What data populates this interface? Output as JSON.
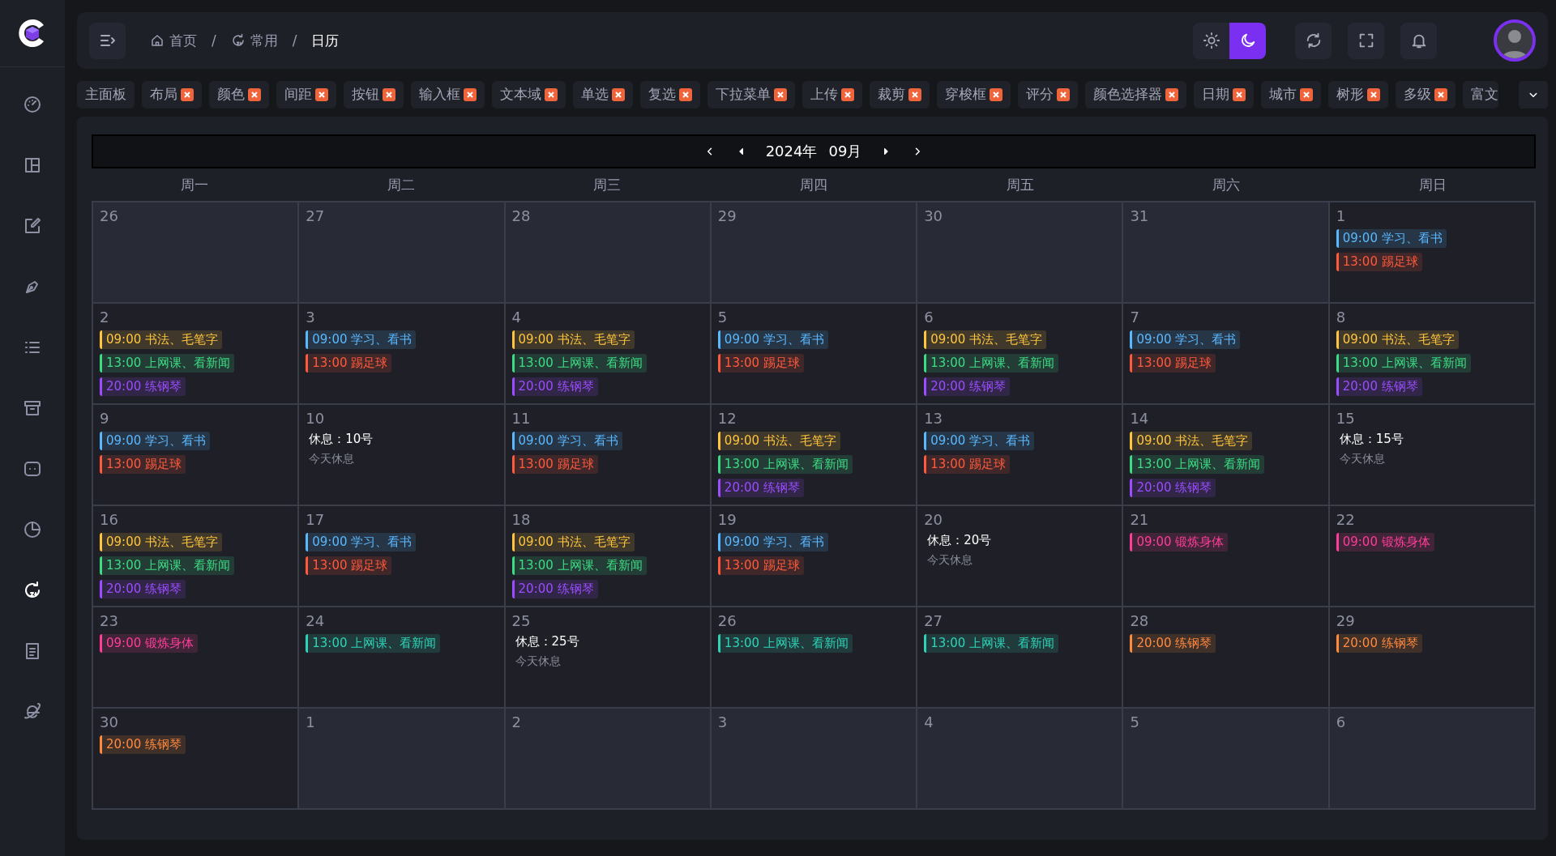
{
  "sidebar": {
    "items": [
      {
        "selected": false
      },
      {
        "selected": false
      },
      {
        "selected": false
      },
      {
        "selected": false
      },
      {
        "selected": false
      },
      {
        "selected": false
      },
      {
        "selected": false
      },
      {
        "selected": false
      },
      {
        "selected": true
      },
      {
        "selected": false
      },
      {
        "selected": false
      }
    ]
  },
  "header": {
    "breadcrumbs": [
      {
        "label": "首页",
        "current": false
      },
      {
        "label": "常用",
        "current": false
      },
      {
        "label": "日历",
        "current": true
      }
    ],
    "separators": [
      "/",
      "/"
    ],
    "theme": [
      {
        "selected": false
      },
      {
        "selected": true
      }
    ]
  },
  "tabs": [
    {
      "label": "主面板",
      "closable": false
    },
    {
      "label": "布局",
      "closable": true
    },
    {
      "label": "颜色",
      "closable": true
    },
    {
      "label": "间距",
      "closable": true
    },
    {
      "label": "按钮",
      "closable": true
    },
    {
      "label": "输入框",
      "closable": true
    },
    {
      "label": "文本域",
      "closable": true
    },
    {
      "label": "单选",
      "closable": true
    },
    {
      "label": "复选",
      "closable": true
    },
    {
      "label": "下拉菜单",
      "closable": true
    },
    {
      "label": "上传",
      "closable": true
    },
    {
      "label": "裁剪",
      "closable": true
    },
    {
      "label": "穿梭框",
      "closable": true
    },
    {
      "label": "评分",
      "closable": true
    },
    {
      "label": "颜色选择器",
      "closable": true
    },
    {
      "label": "日期",
      "closable": true
    },
    {
      "label": "城市",
      "closable": true
    },
    {
      "label": "树形",
      "closable": true
    },
    {
      "label": "多级",
      "closable": true
    },
    {
      "label": "富文",
      "closable": false
    }
  ],
  "calendar": {
    "year": "2024年",
    "month": "09月",
    "weekdays": [
      "周一",
      "周二",
      "周三",
      "周四",
      "周五",
      "周六",
      "周日"
    ],
    "weeks": [
      [
        {
          "day": "26",
          "other_month": true
        },
        {
          "day": "27",
          "other_month": true
        },
        {
          "day": "28",
          "other_month": true
        },
        {
          "day": "29",
          "other_month": true
        },
        {
          "day": "30",
          "other_month": true
        },
        {
          "day": "31",
          "other_month": true
        },
        {
          "day": "1",
          "other_month": false,
          "events": [
            {
              "text": "09:00 学习、看书",
              "color": "#5ab8ff"
            },
            {
              "text": "13:00 踢足球",
              "color": "#ff5a3c"
            }
          ]
        }
      ],
      [
        {
          "day": "2",
          "other_month": false,
          "events": [
            {
              "text": "09:00 书法、毛笔字",
              "color": "#ffc53d"
            },
            {
              "text": "13:00 上网课、看新闻",
              "color": "#3ddc84"
            },
            {
              "text": "20:00 练钢琴",
              "color": "#9b4dff"
            }
          ]
        },
        {
          "day": "3",
          "other_month": false,
          "events": [
            {
              "text": "09:00 学习、看书",
              "color": "#5ab8ff"
            },
            {
              "text": "13:00 踢足球",
              "color": "#ff5a3c"
            }
          ]
        },
        {
          "day": "4",
          "other_month": false,
          "events": [
            {
              "text": "09:00 书法、毛笔字",
              "color": "#ffc53d"
            },
            {
              "text": "13:00 上网课、看新闻",
              "color": "#3ddc84"
            },
            {
              "text": "20:00 练钢琴",
              "color": "#9b4dff"
            }
          ]
        },
        {
          "day": "5",
          "other_month": false,
          "events": [
            {
              "text": "09:00 学习、看书",
              "color": "#5ab8ff"
            },
            {
              "text": "13:00 踢足球",
              "color": "#ff5a3c"
            }
          ]
        },
        {
          "day": "6",
          "other_month": false,
          "events": [
            {
              "text": "09:00 书法、毛笔字",
              "color": "#ffc53d"
            },
            {
              "text": "13:00 上网课、看新闻",
              "color": "#3ddc84"
            },
            {
              "text": "20:00 练钢琴",
              "color": "#9b4dff"
            }
          ]
        },
        {
          "day": "7",
          "other_month": false,
          "events": [
            {
              "text": "09:00 学习、看书",
              "color": "#5ab8ff"
            },
            {
              "text": "13:00 踢足球",
              "color": "#ff5a3c"
            }
          ]
        },
        {
          "day": "8",
          "other_month": false,
          "events": [
            {
              "text": "09:00 书法、毛笔字",
              "color": "#ffc53d"
            },
            {
              "text": "13:00 上网课、看新闻",
              "color": "#3ddc84"
            },
            {
              "text": "20:00 练钢琴",
              "color": "#9b4dff"
            }
          ]
        }
      ],
      [
        {
          "day": "9",
          "other_month": false,
          "events": [
            {
              "text": "09:00 学习、看书",
              "color": "#5ab8ff"
            },
            {
              "text": "13:00 踢足球",
              "color": "#ff5a3c"
            }
          ]
        },
        {
          "day": "10",
          "other_month": false,
          "rest": {
            "title": "休息：10号",
            "note": "今天休息"
          }
        },
        {
          "day": "11",
          "other_month": false,
          "events": [
            {
              "text": "09:00 学习、看书",
              "color": "#5ab8ff"
            },
            {
              "text": "13:00 踢足球",
              "color": "#ff5a3c"
            }
          ]
        },
        {
          "day": "12",
          "other_month": false,
          "events": [
            {
              "text": "09:00 书法、毛笔字",
              "color": "#ffc53d"
            },
            {
              "text": "13:00 上网课、看新闻",
              "color": "#3ddc84"
            },
            {
              "text": "20:00 练钢琴",
              "color": "#9b4dff"
            }
          ]
        },
        {
          "day": "13",
          "other_month": false,
          "events": [
            {
              "text": "09:00 学习、看书",
              "color": "#5ab8ff"
            },
            {
              "text": "13:00 踢足球",
              "color": "#ff5a3c"
            }
          ]
        },
        {
          "day": "14",
          "other_month": false,
          "events": [
            {
              "text": "09:00 书法、毛笔字",
              "color": "#ffc53d"
            },
            {
              "text": "13:00 上网课、看新闻",
              "color": "#3ddc84"
            },
            {
              "text": "20:00 练钢琴",
              "color": "#9b4dff"
            }
          ]
        },
        {
          "day": "15",
          "other_month": false,
          "rest": {
            "title": "休息：15号",
            "note": "今天休息"
          }
        }
      ],
      [
        {
          "day": "16",
          "other_month": false,
          "events": [
            {
              "text": "09:00 书法、毛笔字",
              "color": "#ffc53d"
            },
            {
              "text": "13:00 上网课、看新闻",
              "color": "#3ddc84"
            },
            {
              "text": "20:00 练钢琴",
              "color": "#9b4dff"
            }
          ]
        },
        {
          "day": "17",
          "other_month": false,
          "events": [
            {
              "text": "09:00 学习、看书",
              "color": "#5ab8ff"
            },
            {
              "text": "13:00 踢足球",
              "color": "#ff5a3c"
            }
          ]
        },
        {
          "day": "18",
          "other_month": false,
          "events": [
            {
              "text": "09:00 书法、毛笔字",
              "color": "#ffc53d"
            },
            {
              "text": "13:00 上网课、看新闻",
              "color": "#3ddc84"
            },
            {
              "text": "20:00 练钢琴",
              "color": "#9b4dff"
            }
          ]
        },
        {
          "day": "19",
          "other_month": false,
          "events": [
            {
              "text": "09:00 学习、看书",
              "color": "#5ab8ff"
            },
            {
              "text": "13:00 踢足球",
              "color": "#ff5a3c"
            }
          ]
        },
        {
          "day": "20",
          "other_month": false,
          "rest": {
            "title": "休息：20号",
            "note": "今天休息"
          }
        },
        {
          "day": "21",
          "other_month": false,
          "events": [
            {
              "text": "09:00 锻炼身体",
              "color": "#ff3d9a"
            }
          ]
        },
        {
          "day": "22",
          "other_month": false,
          "events": [
            {
              "text": "09:00 锻炼身体",
              "color": "#ff3d9a"
            }
          ]
        }
      ],
      [
        {
          "day": "23",
          "other_month": false,
          "events": [
            {
              "text": "09:00 锻炼身体",
              "color": "#ff3d9a"
            }
          ]
        },
        {
          "day": "24",
          "other_month": false,
          "events": [
            {
              "text": "13:00 上网课、看新闻",
              "color": "#2ed3b7"
            }
          ]
        },
        {
          "day": "25",
          "other_month": false,
          "rest": {
            "title": "休息：25号",
            "note": "今天休息"
          }
        },
        {
          "day": "26",
          "other_month": false,
          "events": [
            {
              "text": "13:00 上网课、看新闻",
              "color": "#2ed3b7"
            }
          ]
        },
        {
          "day": "27",
          "other_month": false,
          "events": [
            {
              "text": "13:00 上网课、看新闻",
              "color": "#2ed3b7"
            }
          ]
        },
        {
          "day": "28",
          "other_month": false,
          "events": [
            {
              "text": "20:00 练钢琴",
              "color": "#ff8a3d"
            }
          ]
        },
        {
          "day": "29",
          "other_month": false,
          "events": [
            {
              "text": "20:00 练钢琴",
              "color": "#ff8a3d"
            }
          ]
        }
      ],
      [
        {
          "day": "30",
          "other_month": false,
          "events": [
            {
              "text": "20:00 练钢琴",
              "color": "#ff8a3d"
            }
          ]
        },
        {
          "day": "1",
          "other_month": true
        },
        {
          "day": "2",
          "other_month": true
        },
        {
          "day": "3",
          "other_month": true
        },
        {
          "day": "4",
          "other_month": true
        },
        {
          "day": "5",
          "other_month": true
        },
        {
          "day": "6",
          "other_month": true
        }
      ]
    ]
  }
}
